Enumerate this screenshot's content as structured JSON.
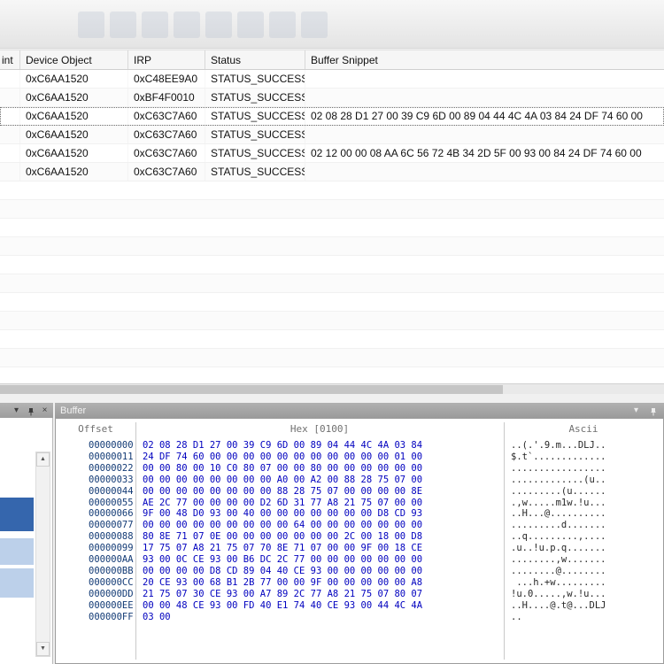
{
  "icons": {
    "chevron_down": "▾",
    "close": "×",
    "arrow_up": "▲",
    "arrow_down": "▼"
  },
  "colors": {
    "selection_blue": "#3566ad",
    "selection_light_blue": "#bcd0ea",
    "hex_text": "#0000bf",
    "offset_text": "#123a75"
  },
  "table": {
    "columns": [
      "int",
      "Device Object",
      "IRP",
      "Status",
      "Buffer Snippet"
    ],
    "rows": [
      {
        "endpoint": "",
        "device_object": "0xC6AA1520",
        "irp": "0xC48EE9A0",
        "status": "STATUS_SUCCESS",
        "buffer": "",
        "focused": false
      },
      {
        "endpoint": "",
        "device_object": "0xC6AA1520",
        "irp": "0xBF4F0010",
        "status": "STATUS_SUCCESS",
        "buffer": "",
        "focused": false
      },
      {
        "endpoint": "",
        "device_object": "0xC6AA1520",
        "irp": "0xC63C7A60",
        "status": "STATUS_SUCCESS",
        "buffer": "02 08 28 D1 27 00 39 C9 6D 00 89 04 44 4C 4A 03 84 24 DF 74 60 00",
        "focused": true
      },
      {
        "endpoint": "",
        "device_object": "0xC6AA1520",
        "irp": "0xC63C7A60",
        "status": "STATUS_SUCCESS",
        "buffer": "",
        "focused": false
      },
      {
        "endpoint": "",
        "device_object": "0xC6AA1520",
        "irp": "0xC63C7A60",
        "status": "STATUS_SUCCESS",
        "buffer": "02 12 00 00 08 AA 6C 56 72 4B 34 2D 5F 00 93 00 84 24 DF 74 60 00",
        "focused": false
      },
      {
        "endpoint": "",
        "device_object": "0xC6AA1520",
        "irp": "0xC63C7A60",
        "status": "STATUS_SUCCESS",
        "buffer": "",
        "focused": false
      }
    ]
  },
  "buffer_panel": {
    "title": "Buffer",
    "columns": [
      "Offset",
      "Hex [0100]",
      "Ascii"
    ],
    "hex_rows": [
      {
        "offset": "00000000",
        "hex": "02 08 28 D1 27 00 39 C9 6D 00 89 04 44 4C 4A 03 84",
        "ascii": "..(.'.9.m...DLJ.."
      },
      {
        "offset": "00000011",
        "hex": "24 DF 74 60 00 00 00 00 00 00 00 00 00 00 00 01 00",
        "ascii": "$.t`............."
      },
      {
        "offset": "00000022",
        "hex": "00 00 80 00 10 C0 80 07 00 00 80 00 00 00 00 00 00",
        "ascii": "................."
      },
      {
        "offset": "00000033",
        "hex": "00 00 00 00 00 00 00 00 A0 00 A2 00 88 28 75 07 00",
        "ascii": ".............(u.."
      },
      {
        "offset": "00000044",
        "hex": "00 00 00 00 00 00 00 00 88 28 75 07 00 00 00 00 8E",
        "ascii": ".........(u......"
      },
      {
        "offset": "00000055",
        "hex": "AE 2C 77 00 00 00 00 D2 6D 31 77 A8 21 75 07 00 00",
        "ascii": ".,w.....m1w.!u..."
      },
      {
        "offset": "00000066",
        "hex": "9F 00 48 D0 93 00 40 00 00 00 00 00 00 00 D8 CD 93",
        "ascii": "..H...@.........."
      },
      {
        "offset": "00000077",
        "hex": "00 00 00 00 00 00 00 00 00 64 00 00 00 00 00 00 00",
        "ascii": ".........d......."
      },
      {
        "offset": "00000088",
        "hex": "80 8E 71 07 0E 00 00 00 00 00 00 00 2C 00 18 00 D8",
        "ascii": "..q.........,...."
      },
      {
        "offset": "00000099",
        "hex": "17 75 07 A8 21 75 07 70 8E 71 07 00 00 9F 00 18 CE",
        "ascii": ".u..!u.p.q......."
      },
      {
        "offset": "000000AA",
        "hex": "93 00 0C CE 93 00 B6 DC 2C 77 00 00 00 00 00 00 00",
        "ascii": "........,w......."
      },
      {
        "offset": "000000BB",
        "hex": "00 00 00 00 D8 CD 89 04 40 CE 93 00 00 00 00 00 00",
        "ascii": "........@........"
      },
      {
        "offset": "000000CC",
        "hex": "20 CE 93 00 68 B1 2B 77 00 00 9F 00 00 00 00 00 A8",
        "ascii": " ...h.+w........."
      },
      {
        "offset": "000000DD",
        "hex": "21 75 07 30 CE 93 00 A7 89 2C 77 A8 21 75 07 80 07",
        "ascii": "!u.0.....,w.!u..."
      },
      {
        "offset": "000000EE",
        "hex": "00 00 48 CE 93 00 FD 40 E1 74 40 CE 93 00 44 4C 4A",
        "ascii": "..H....@.t@...DLJ"
      },
      {
        "offset": "000000FF",
        "hex": "03 00",
        "ascii": ".."
      }
    ]
  }
}
